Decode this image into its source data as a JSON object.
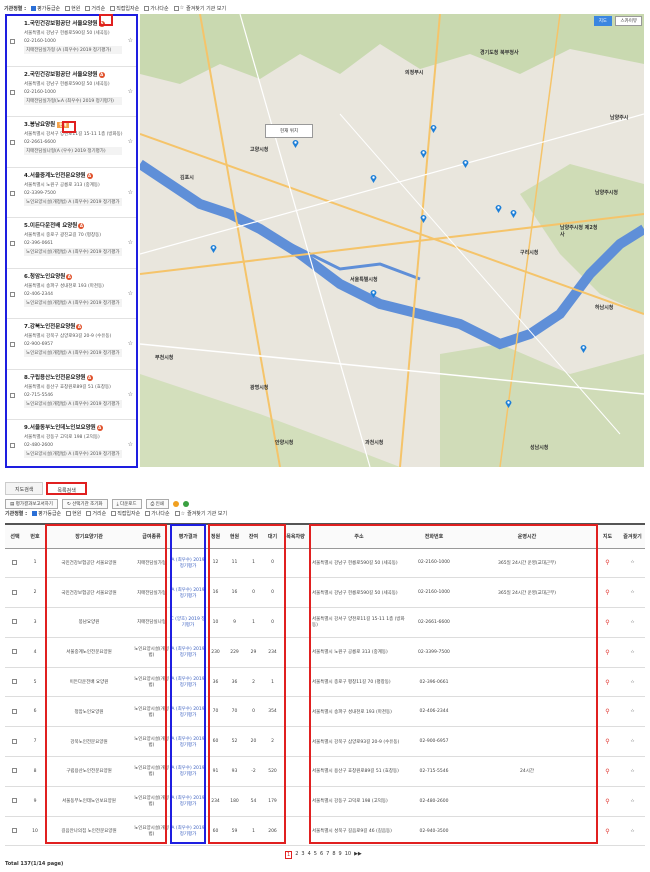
{
  "sort_bar": {
    "label": "기관정렬 :",
    "options": [
      {
        "label": "평가등급순",
        "checked": true
      },
      {
        "label": "현원",
        "checked": false
      },
      {
        "label": "거리순",
        "checked": false
      },
      {
        "label": "직접입자순",
        "checked": false
      },
      {
        "label": "가나다순",
        "checked": false
      }
    ],
    "favorites": "즐겨찾기 기관 보기"
  },
  "list": [
    {
      "name": "1.국민건강보험공단 서울요양원",
      "addr": "서울특별시 강남구 헌릉로590길 50 (세곡동)",
      "tel": "02-2160-1000",
      "grade": "치매전담실가형 (A (최우수) 2019 정기평가)"
    },
    {
      "name": "2.국민건강보험공단 서울요양원",
      "addr": "서울특별시 강남구 헌릉로590길 50 (세곡동)",
      "tel": "02-2160-1000",
      "grade": "치매전담실가형(노A (최우수) 2019 정기평가)"
    },
    {
      "name": "3.봉남요양원",
      "tag": "현재",
      "addr": "서울특별시 강서구 양천로11길 15-11 1층 (방화동)",
      "tel": "02-2661-6600",
      "grade": "치매전담실나형(A (우수) 2019 정기평가)"
    },
    {
      "name": "4.서울중계노인전문요양원",
      "addr": "서울특별시 노원구 공릉로 313 (중계동)",
      "tel": "02-3399-7500",
      "grade": "노인요양시설(개정법) A (최우수) 2019 정기평가"
    },
    {
      "name": "5.이든다운전배 요양원",
      "addr": "서울특별시 중로구 광진교길 70 (평창동)",
      "tel": "02-396-0661",
      "grade": "노인요양시설(개정법) A (최우수) 2019 정기평가"
    },
    {
      "name": "6.청암노인요양원",
      "addr": "서울특별시 송파구 성내천로 193 (마천동)",
      "tel": "02-406-2344",
      "grade": "노인요양시설(개정법) A (최우수) 2019 정기평가"
    },
    {
      "name": "7.강북노인전문요양원",
      "addr": "서울특별시 강북구 삼양로93길 20-9 (수유동)",
      "tel": "02-900-6957",
      "grade": "노인요양시설(개정법) A (최우수) 2019 정기평가"
    },
    {
      "name": "8.구립용산노인전문요양원",
      "addr": "서울특별시 용산구 효창원로89길 51 (효창동)",
      "tel": "02-715-5546",
      "grade": "노인요양시설(개정법) A (최우수) 2019 정기평가"
    },
    {
      "name": "9.서울동부노인데노인보요양원",
      "addr": "서울특별시 강동구 고덕로 198 (고덕동)",
      "tel": "02-480-2600",
      "grade": "노인요양시설(개정법) A (최우수) 2019 정기평가"
    }
  ],
  "map": {
    "btn_map": "지도",
    "btn_sky": "스카이뷰",
    "popup": "현재 위치",
    "labels": {
      "gimpo": "김포시",
      "seoul": "서울특별시청",
      "goyang": "고양시청",
      "uijeongbu": "의정부시",
      "guri": "구리시청",
      "hanam": "하남시청",
      "bucheon": "부천시청",
      "gwangmyeong": "광명시청",
      "anyang": "안양시청",
      "gwacheon": "과천시청",
      "seongnam": "성남시청",
      "namyangju": "남양주시청",
      "gyeonggi": "경기도청 북부청사",
      "namyangju2": "남양주시청 제2청사",
      "gapyeong": "남양주시"
    }
  },
  "tabs": {
    "map": "지도검색",
    "list": "목록검색"
  },
  "toolbar": {
    "print_all": "평가결과보고서하기",
    "select_all": "선택기관 조기화",
    "download": "다운로드",
    "print": "인쇄"
  },
  "table": {
    "headers": [
      "선택",
      "번호",
      "장기요양기관",
      "급여종류",
      "평가결과",
      "정원",
      "현원",
      "잔여",
      "대기",
      "목욕차량",
      "주소",
      "전화번호",
      "운영시간",
      "지도",
      "즐겨찾기"
    ],
    "rows": [
      {
        "no": "1",
        "name": "국민건강보험공단 서울요양원",
        "type": "치매전담실가형",
        "grade": "A (최우수) 2019 정기평가",
        "cap": "12",
        "cur": "11",
        "rem": "1",
        "wait": "0",
        "addr": "서울특별시 강남구 헌릉로590길 50 (세곡동)",
        "tel": "02-2160-1000",
        "hours": "365일 24시간 운영(교대근무)"
      },
      {
        "no": "2",
        "name": "국민건강보험공단 서울요양원",
        "type": "치매전담실가형",
        "grade": "A (최우수) 2019 정기평가",
        "cap": "16",
        "cur": "16",
        "rem": "0",
        "wait": "0",
        "addr": "서울특별시 강남구 헌릉로590길 50 (세곡동)",
        "tel": "02-2160-1000",
        "hours": "365일 24시간 운영(교대근무)"
      },
      {
        "no": "3",
        "name": "봉남요양원",
        "type": "치매전담실나형",
        "grade": "C (양호) 2019 정기평가",
        "cap": "10",
        "cur": "9",
        "rem": "1",
        "wait": "0",
        "addr": "서울특별시 강서구 양천로11길 15-11 1층 (방화동)",
        "tel": "02-2661-6600",
        "hours": ""
      },
      {
        "no": "4",
        "name": "서울중계노인전문요양원",
        "type": "노인요양시설(개정법)",
        "grade": "A (최우수) 2019 정기평가",
        "cap": "230",
        "cur": "229",
        "rem": "29",
        "wait": "234",
        "addr": "서울특별시 노원구 공릉로 313 (중계동)",
        "tel": "02-3399-7500",
        "hours": ""
      },
      {
        "no": "5",
        "name": "이든다운전배 요양원",
        "type": "노인요양시설(개정법)",
        "grade": "A (최우수) 2019 정기평가",
        "cap": "36",
        "cur": "36",
        "rem": "2",
        "wait": "1",
        "addr": "서울특별시 종로구 평창11길 70 (평창동)",
        "tel": "02-396-0661",
        "hours": ""
      },
      {
        "no": "6",
        "name": "청암노인요양원",
        "type": "노인요양시설(개정법)",
        "grade": "A (최우수) 2019 정기평가",
        "cap": "70",
        "cur": "70",
        "rem": "0",
        "wait": "354",
        "addr": "서울특별시 송파구 성내천로 193 (마천동)",
        "tel": "02-406-2344",
        "hours": ""
      },
      {
        "no": "7",
        "name": "강북노인전문요양원",
        "type": "노인요양시설(개정법)",
        "grade": "A (최우수) 2019 정기평가",
        "cap": "60",
        "cur": "52",
        "rem": "20",
        "wait": "2",
        "addr": "서울특별시 강북구 삼양로93길 20-9 (수유동)",
        "tel": "02-900-6957",
        "hours": ""
      },
      {
        "no": "8",
        "name": "구립용산노인전문요양원",
        "type": "노인요양시설(개정법)",
        "grade": "A (최우수) 2019 정기평가",
        "cap": "91",
        "cur": "93",
        "rem": "-2",
        "wait": "520",
        "addr": "서울특별시 용산구 효창원로89길 51 (효창동)",
        "tel": "02-715-5546",
        "hours": "24시간"
      },
      {
        "no": "9",
        "name": "서울동부노인데노인보요양원",
        "type": "노인요양시설(개정법)",
        "grade": "A (최우수) 2019 정기평가",
        "cap": "234",
        "cur": "180",
        "rem": "54",
        "wait": "179",
        "addr": "서울특별시 강동구 고덕로 198 (고덕동)",
        "tel": "02-480-2600",
        "hours": ""
      },
      {
        "no": "10",
        "name": "길음안나의집 노인전문요양원",
        "type": "노인요양시설(개정법)",
        "grade": "A (최우수) 2019 정기평가",
        "cap": "60",
        "cur": "59",
        "rem": "1",
        "wait": "206",
        "addr": "서울특별시 성북구 길음로9길 46 (길음동)",
        "tel": "02-940-3500",
        "hours": ""
      }
    ]
  },
  "pager": {
    "pages": [
      "1",
      "2",
      "3",
      "4",
      "5",
      "6",
      "7",
      "8",
      "9",
      "10"
    ],
    "next": "▶▶"
  },
  "total": "Total 137(1/14 page)",
  "colors": {
    "highlight_blue": "#1e1ee0",
    "highlight_red": "#e02020",
    "badge": "#e0502a",
    "pin": "#1d7fd8"
  }
}
